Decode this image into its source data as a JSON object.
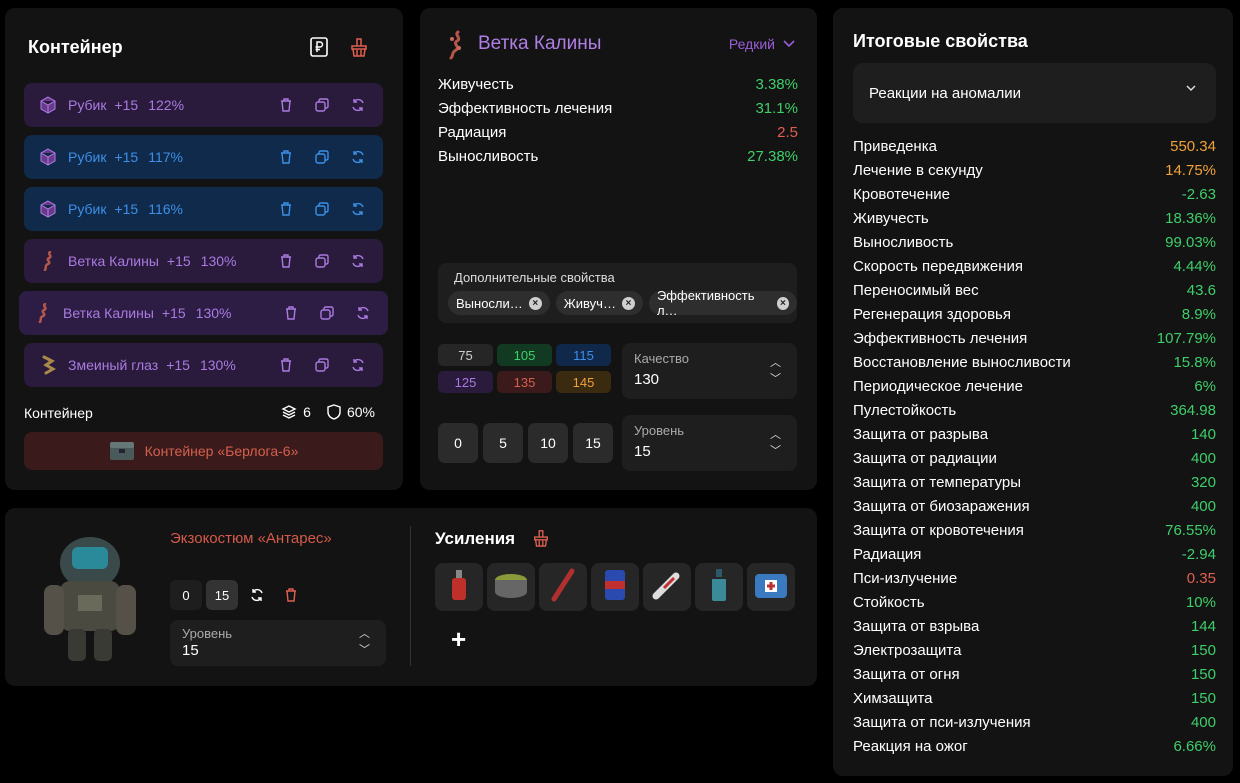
{
  "colors": {
    "green": "#3fcf6a",
    "orange": "#f0a23a",
    "red": "#e0604f",
    "purple": "#a97be0",
    "blue": "#3d8fe8"
  },
  "container": {
    "title": "Контейнер",
    "ruble_icon": "ruble-icon",
    "clear_icon": "broom-icon",
    "rows": [
      {
        "name": "Рубик",
        "level": "+15",
        "percent": "122%",
        "style": "row-purple",
        "icon": "cube-icon"
      },
      {
        "name": "Рубик",
        "level": "+15",
        "percent": "117%",
        "style": "row-blue",
        "icon": "cube-icon"
      },
      {
        "name": "Рубик",
        "level": "+15",
        "percent": "116%",
        "style": "row-blue",
        "icon": "cube-icon"
      },
      {
        "name": "Ветка Калины",
        "level": "+15",
        "percent": "130%",
        "style": "row-purple",
        "icon": "branch-icon"
      },
      {
        "name": "Ветка Калины",
        "level": "+15",
        "percent": "130%",
        "style": "row-purple2",
        "icon": "branch-icon"
      },
      {
        "name": "Змеиный глаз",
        "level": "+15",
        "percent": "130%",
        "style": "row-purple",
        "icon": "eye-icon"
      }
    ],
    "footer_label": "Контейнер",
    "slots": "6",
    "protection": "60%",
    "container_button": "Контейнер «Берлога-6»"
  },
  "artifact": {
    "title": "Ветка Калины",
    "rarity": "Редкий",
    "stats": [
      {
        "name": "Живучесть",
        "value": "3.38%",
        "color": "green"
      },
      {
        "name": "Эффективность лечения",
        "value": "31.1%",
        "color": "green"
      },
      {
        "name": "Радиация",
        "value": "2.5",
        "color": "red"
      },
      {
        "name": "Выносливость",
        "value": "27.38%",
        "color": "green"
      }
    ],
    "extra_label": "Дополнительные свойства",
    "chips": [
      "Выносли…",
      "Живуч…",
      "Эффективность л…"
    ],
    "quality_cells": [
      {
        "value": "75",
        "bg": "#262626",
        "fg": "#cfcfcf"
      },
      {
        "value": "105",
        "bg": "#123a22",
        "fg": "#3fcf6a"
      },
      {
        "value": "115",
        "bg": "#10294a",
        "fg": "#3d8fe8"
      },
      {
        "value": "125",
        "bg": "#2a1a3c",
        "fg": "#a97be0"
      },
      {
        "value": "135",
        "bg": "#3a1a1a",
        "fg": "#d4604f"
      },
      {
        "value": "145",
        "bg": "#3a2a10",
        "fg": "#f0a23a"
      }
    ],
    "quality_label": "Качество",
    "quality_value": "130",
    "level_buttons": [
      "0",
      "5",
      "10",
      "15"
    ],
    "level_label": "Уровень",
    "level_value": "15"
  },
  "summary": {
    "title": "Итоговые свойства",
    "dropdown": "Реакции на аномалии",
    "rows": [
      {
        "name": "Приведенка",
        "value": "550.34",
        "color": "orange"
      },
      {
        "name": "Лечение в секунду",
        "value": "14.75%",
        "color": "orange"
      },
      {
        "name": "Кровотечение",
        "value": "-2.63",
        "color": "green"
      },
      {
        "name": "Живучесть",
        "value": "18.36%",
        "color": "green"
      },
      {
        "name": "Выносливость",
        "value": "99.03%",
        "color": "green"
      },
      {
        "name": "Скорость передвижения",
        "value": "4.44%",
        "color": "green"
      },
      {
        "name": "Переносимый вес",
        "value": "43.6",
        "color": "green"
      },
      {
        "name": "Регенерация здоровья",
        "value": "8.9%",
        "color": "green"
      },
      {
        "name": "Эффективность лечения",
        "value": "107.79%",
        "color": "green"
      },
      {
        "name": "Восстановление выносливости",
        "value": "15.8%",
        "color": "green"
      },
      {
        "name": "Периодическое лечение",
        "value": "6%",
        "color": "green"
      },
      {
        "name": "Пулестойкость",
        "value": "364.98",
        "color": "green"
      },
      {
        "name": "Защита от разрыва",
        "value": "140",
        "color": "green"
      },
      {
        "name": "Защита от радиации",
        "value": "400",
        "color": "green"
      },
      {
        "name": "Защита от температуры",
        "value": "320",
        "color": "green"
      },
      {
        "name": "Защита от биозаражения",
        "value": "400",
        "color": "green"
      },
      {
        "name": "Защита от кровотечения",
        "value": "76.55%",
        "color": "green"
      },
      {
        "name": "Радиация",
        "value": "-2.94",
        "color": "green"
      },
      {
        "name": "Пси-излучение",
        "value": "0.35",
        "color": "red"
      },
      {
        "name": "Стойкость",
        "value": "10%",
        "color": "green"
      },
      {
        "name": "Защита от взрыва",
        "value": "144",
        "color": "green"
      },
      {
        "name": "Электрозащита",
        "value": "150",
        "color": "green"
      },
      {
        "name": "Защита от огня",
        "value": "150",
        "color": "green"
      },
      {
        "name": "Химзащита",
        "value": "150",
        "color": "green"
      },
      {
        "name": "Защита от пси-излучения",
        "value": "400",
        "color": "green"
      },
      {
        "name": "Реакция на ожог",
        "value": "6.66%",
        "color": "green"
      }
    ]
  },
  "suit": {
    "name": "Экзокостюм «Антарес»",
    "level_buttons": [
      "0",
      "15"
    ],
    "level_label": "Уровень",
    "level_value": "15",
    "boost_title": "Усиления",
    "boosts": [
      "red-bottle-icon",
      "pot-icon",
      "stick-icon",
      "can-icon",
      "syringe-icon",
      "bottle-icon",
      "medkit-icon"
    ],
    "add_label": "+"
  }
}
